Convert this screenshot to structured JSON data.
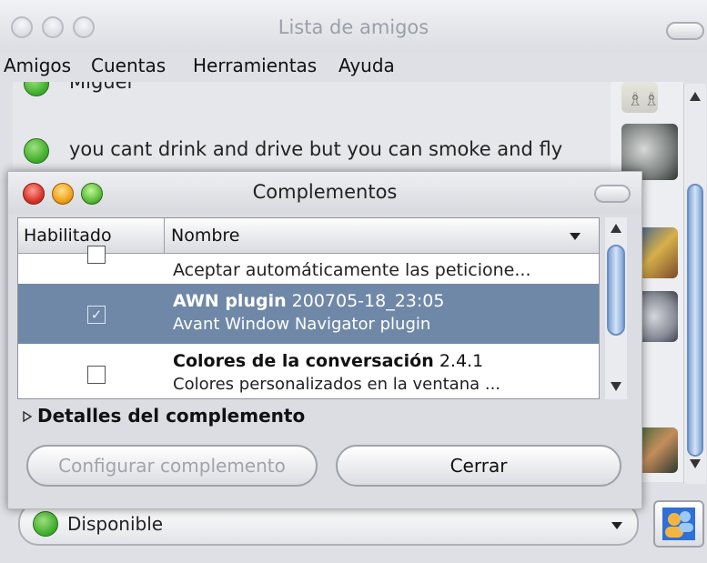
{
  "main_window": {
    "title": "Lista de amigos",
    "menu": [
      {
        "label": "Amigos"
      },
      {
        "label": "Cuentas"
      },
      {
        "label": "Herramientas"
      },
      {
        "label": "Ayuda"
      }
    ],
    "buddies": [
      {
        "name": "Miguel"
      },
      {
        "name": "you cant drink and drive but you can smoke and fly"
      }
    ],
    "status": {
      "value": "Disponible"
    }
  },
  "dialog": {
    "title": "Complementos",
    "columns": [
      "Habilitado",
      "Nombre"
    ],
    "plugins": [
      {
        "name": "",
        "version": "",
        "description": "Aceptar automáticamente las peticione...",
        "enabled": false
      },
      {
        "name": "AWN plugin",
        "version": "200705-18_23:05",
        "description": "Avant Window Navigator plugin",
        "enabled": true,
        "selected": true
      },
      {
        "name": "Colores de la conversación",
        "version": "2.4.1",
        "description": "Colores personalizados en la ventana ...",
        "enabled": false
      }
    ],
    "details_label": "Detalles del complemento",
    "configure_button": "Configurar complemento",
    "close_button": "Cerrar"
  },
  "colors": {
    "selection": "#6f88a8",
    "status_green": "#3fae2c",
    "close_red": "#d9362b",
    "minimize_orange": "#f0a21c",
    "zoom_green": "#5bbd3a"
  }
}
